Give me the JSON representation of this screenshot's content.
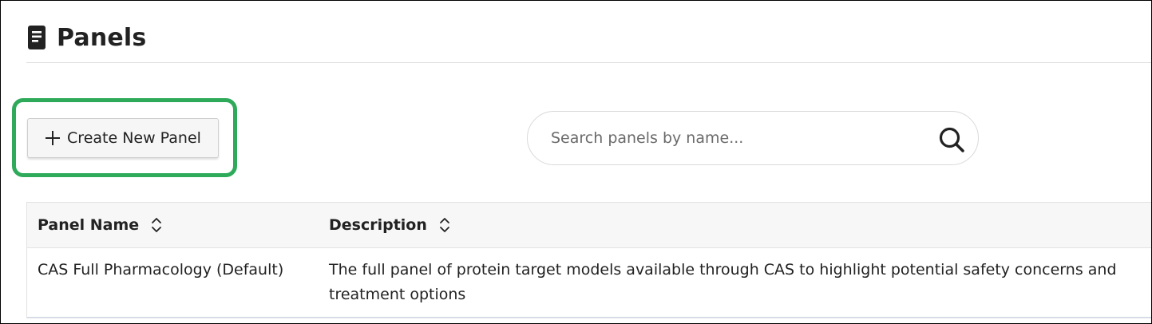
{
  "header": {
    "title": "Panels",
    "icon": "document-icon"
  },
  "toolbar": {
    "create_label": "Create New Panel",
    "create_icon": "plus-icon",
    "highlight_color": "#2eaa5a"
  },
  "search": {
    "placeholder": "Search panels by name...",
    "value": "",
    "icon": "search-icon"
  },
  "table": {
    "columns": [
      {
        "label": "Panel Name",
        "sortable": true
      },
      {
        "label": "Description",
        "sortable": true
      }
    ],
    "rows": [
      {
        "name": "CAS Full Pharmacology (Default)",
        "description": "The full panel of protein target models available through CAS to highlight potential safety concerns and treatment options"
      }
    ]
  }
}
